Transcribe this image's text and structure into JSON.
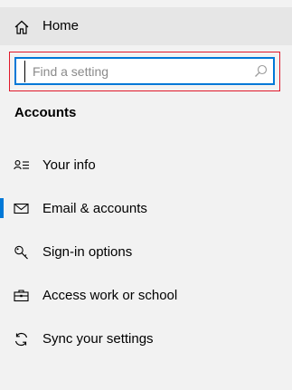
{
  "home": {
    "label": "Home",
    "icon": "home-icon"
  },
  "search": {
    "placeholder": "Find a setting",
    "value": "",
    "icon": "search-icon"
  },
  "section": {
    "title": "Accounts"
  },
  "nav": {
    "active_index": 1,
    "items": [
      {
        "label": "Your info",
        "icon": "person-icon"
      },
      {
        "label": "Email & accounts",
        "icon": "mail-icon"
      },
      {
        "label": "Sign-in options",
        "icon": "key-icon"
      },
      {
        "label": "Access work or school",
        "icon": "briefcase-icon"
      },
      {
        "label": "Sync your settings",
        "icon": "sync-icon"
      }
    ]
  },
  "colors": {
    "accent": "#0078d7",
    "highlight_border": "#e0182a",
    "background": "#f2f2f2",
    "home_bg": "#e6e6e6"
  }
}
